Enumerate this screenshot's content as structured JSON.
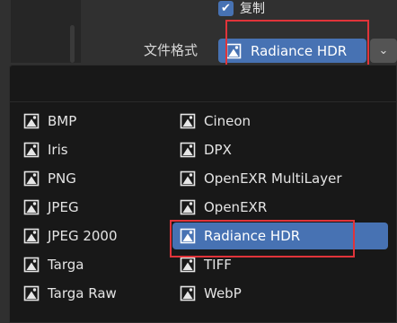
{
  "copy": {
    "label": "复制",
    "checked": true,
    "check_glyph": "✔"
  },
  "file_format": {
    "label": "文件格式",
    "selected": "Radiance HDR",
    "expand_glyph": "⌄"
  },
  "menu": {
    "left_column": [
      {
        "label": "BMP",
        "icon": "image-icon"
      },
      {
        "label": "Iris",
        "icon": "image-icon"
      },
      {
        "label": "PNG",
        "icon": "image-icon"
      },
      {
        "label": "JPEG",
        "icon": "image-icon"
      },
      {
        "label": "JPEG 2000",
        "icon": "image-icon"
      },
      {
        "label": "Targa",
        "icon": "image-icon"
      },
      {
        "label": "Targa Raw",
        "icon": "image-icon"
      }
    ],
    "right_column": [
      {
        "label": "Cineon",
        "icon": "image-icon"
      },
      {
        "label": "DPX",
        "icon": "image-icon"
      },
      {
        "label": "OpenEXR MultiLayer",
        "icon": "image-icon"
      },
      {
        "label": "OpenEXR",
        "icon": "image-icon"
      },
      {
        "label": "Radiance HDR",
        "icon": "image-icon",
        "active": true
      },
      {
        "label": "TIFF",
        "icon": "image-icon"
      },
      {
        "label": "WebP",
        "icon": "image-icon"
      }
    ]
  },
  "colors": {
    "accent": "#4772b3",
    "highlight_box": "#e0343a",
    "menu_background": "#181818",
    "panel_background": "#303030"
  }
}
